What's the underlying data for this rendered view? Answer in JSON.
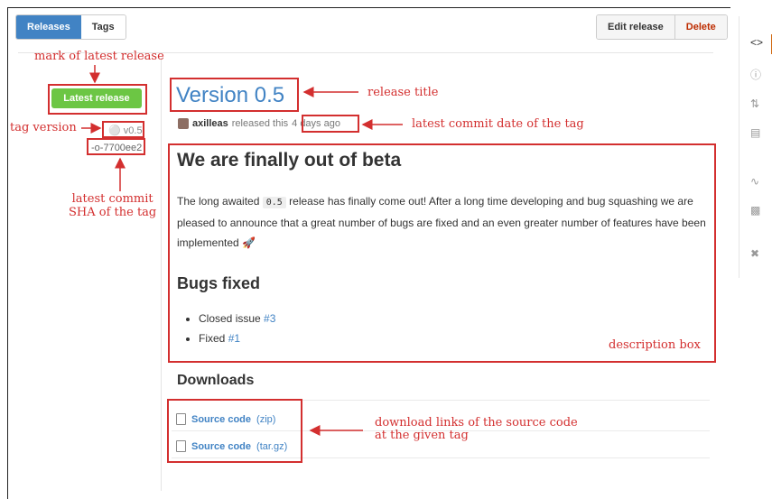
{
  "tabs": [
    "Releases",
    "Tags"
  ],
  "actions": {
    "edit": "Edit release",
    "delete": "Delete"
  },
  "release": {
    "latest_badge": "Latest release",
    "tag": "v0.5",
    "sha": "7700ee2",
    "title": "Version 0.5",
    "author": "axilleas",
    "released_text": "released this",
    "date": "4 days ago"
  },
  "description": {
    "heading": "We are finally out of beta",
    "p_before": "The long awaited",
    "p_code": "0.5",
    "p_after": "release has finally come out! After a long time developing and bug squashing we are pleased to announce that a great number of bugs are fixed and an even greater number of features have been implemented 🚀",
    "bugs_heading": "Bugs fixed",
    "bugs": [
      {
        "text": "Closed issue",
        "link": "#3"
      },
      {
        "text": "Fixed",
        "link": "#1"
      }
    ]
  },
  "downloads": {
    "title": "Downloads",
    "items": [
      {
        "label": "Source code",
        "format": "(zip)"
      },
      {
        "label": "Source code",
        "format": "(tar.gz)"
      }
    ]
  },
  "annotations": {
    "latest_mark": "mark of latest release",
    "release_title": "release title",
    "tag_version": "tag version",
    "commit_date": "latest commit date of the tag",
    "sha_1": "latest commit",
    "sha_2": "SHA of the tag",
    "desc_box": "description box",
    "dl_1": "download links of the source code",
    "dl_2": "at the given tag"
  },
  "colors": {
    "accent": "#4183c4",
    "latest": "#6cc644",
    "annotation": "#d32f2f",
    "delete": "#bd2c00"
  },
  "sidebar_icons": [
    "code-icon",
    "issues-icon",
    "pull-request-icon",
    "wiki-icon",
    "pulse-icon",
    "graphs-icon",
    "settings-icon"
  ]
}
